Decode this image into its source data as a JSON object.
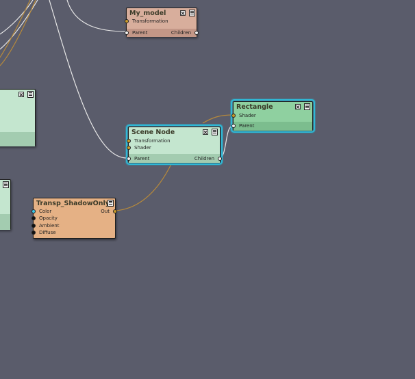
{
  "nodes": {
    "my_model": {
      "title": "My_model",
      "ports": {
        "transformation": "Transformation",
        "parent": "Parent",
        "children": "Children"
      },
      "color": "#d8ae9c"
    },
    "scene_node": {
      "title": "Scene Node",
      "ports": {
        "transformation": "Transformation",
        "shader": "Shader",
        "parent": "Parent",
        "children": "Children"
      },
      "color": "#c4e6cf"
    },
    "rectangle": {
      "title": "Rectangle",
      "ports": {
        "shader": "Shader",
        "parent": "Parent"
      },
      "color": "#8fd0a0"
    },
    "transp_shadow": {
      "title": "Transp_ShadowOnly",
      "ports": {
        "color": "Color",
        "opacity": "Opacity",
        "ambient": "Ambient",
        "diffuse": "Diffuse",
        "out": "Out"
      },
      "color": "#e5b185"
    }
  },
  "colors": {
    "background": "#5a5c6b",
    "wire_white": "#e8e8e8",
    "wire_gold": "#b88a3a",
    "selection": "#2fb8d6"
  }
}
